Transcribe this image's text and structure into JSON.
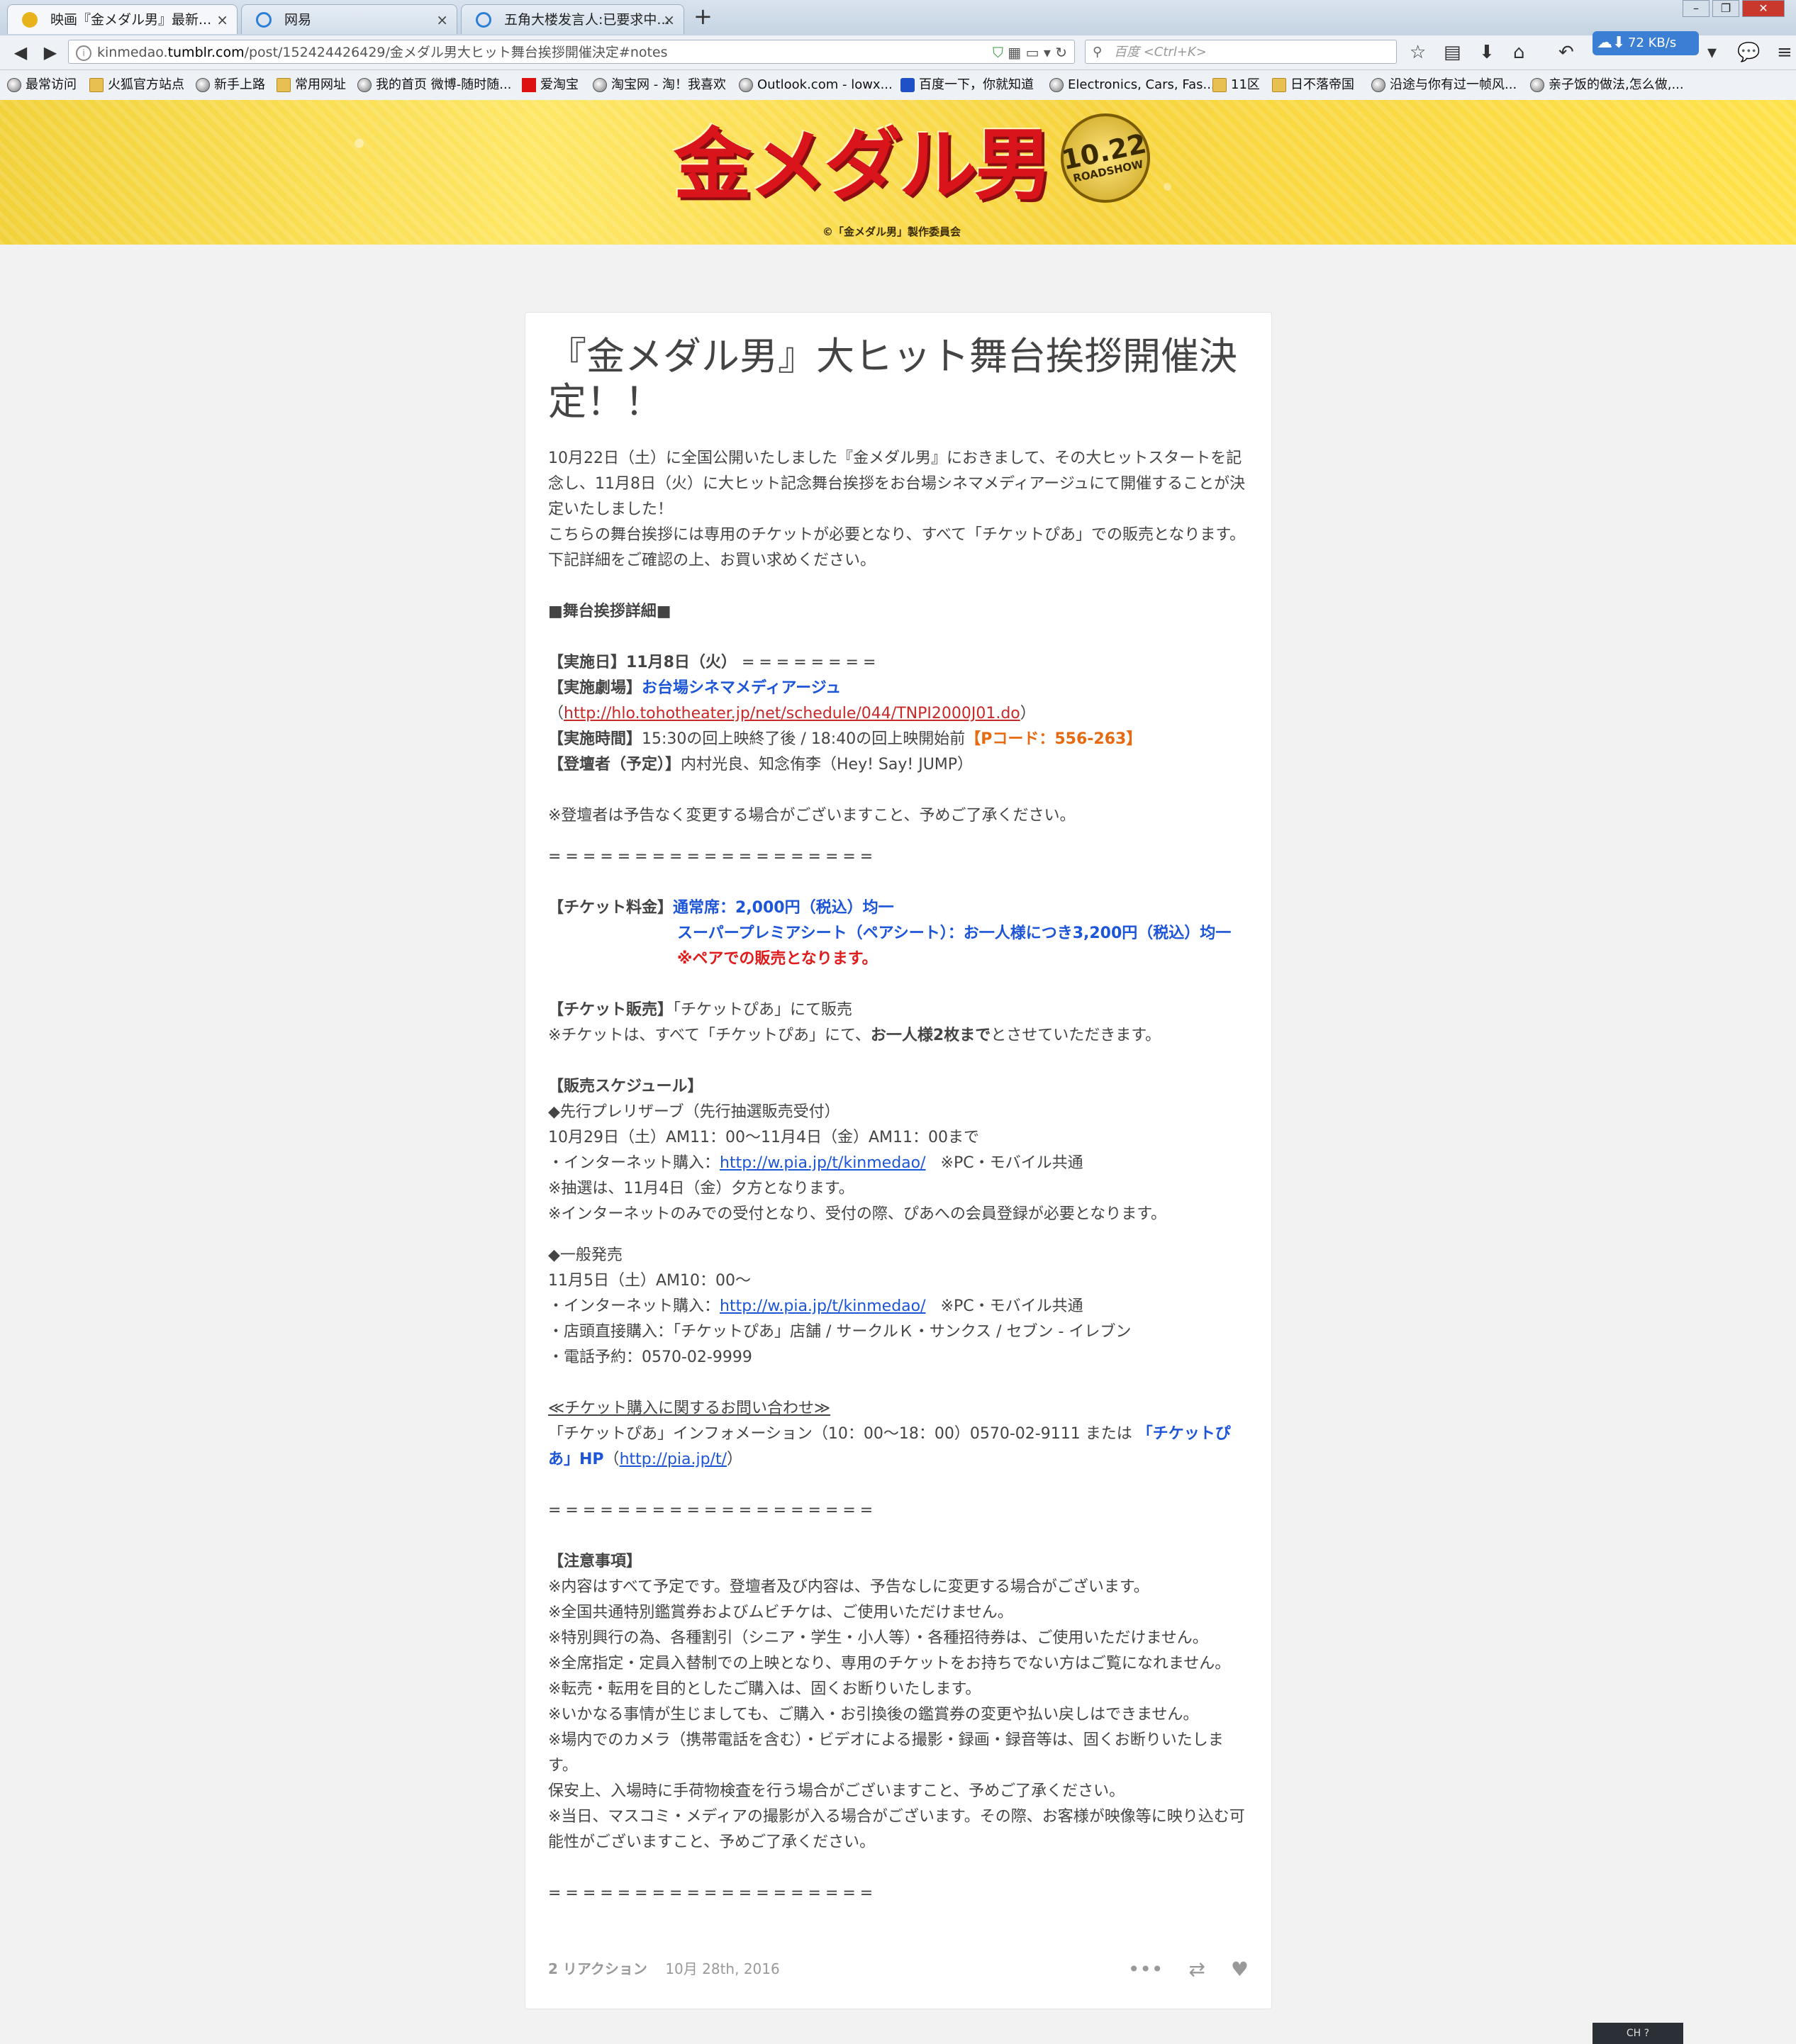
{
  "browser": {
    "tabs": [
      {
        "title": "映画『金メダル男』最新...",
        "active": true
      },
      {
        "title": "网易",
        "active": false
      },
      {
        "title": "五角大楼发言人:已要求中...",
        "active": false
      }
    ],
    "new_tab": "+",
    "url_prefix": "kinmedao.",
    "url_host": "tumblr.com",
    "url_path": "/post/152424426429/金メダル男大ヒット舞台挨拶開催決定#notes",
    "search_placeholder": "百度 <Ctrl+K>",
    "download_speed": "72 KB/s",
    "bookmarks": [
      {
        "label": "最常访问",
        "icon": "globe"
      },
      {
        "label": "火狐官方站点",
        "icon": "folder"
      },
      {
        "label": "新手上路",
        "icon": "globe"
      },
      {
        "label": "常用网址",
        "icon": "folder"
      },
      {
        "label": "我的首页 微博-随时随...",
        "icon": "globe"
      },
      {
        "label": "爱淘宝",
        "icon": "red"
      },
      {
        "label": "淘宝网 - 淘！我喜欢",
        "icon": "globe"
      },
      {
        "label": "Outlook.com - lowx...",
        "icon": "globe"
      },
      {
        "label": "百度一下，你就知道",
        "icon": "paw"
      },
      {
        "label": "Electronics, Cars, Fas...",
        "icon": "globe"
      },
      {
        "label": "11区",
        "icon": "folder"
      },
      {
        "label": "日不落帝国",
        "icon": "folder"
      },
      {
        "label": "沿途与你有过一帧风...",
        "icon": "globe"
      },
      {
        "label": "亲子饭的做法,怎么做,...",
        "icon": "globe"
      }
    ]
  },
  "banner": {
    "logo_text": "金メダル男",
    "badge_date": "10.22",
    "badge_sub": "ROADSHOW",
    "copyright": "©「金メダル男」製作委員会"
  },
  "post": {
    "title": "『金メダル男』大ヒット舞台挨拶開催決定！！",
    "intro": [
      "10月22日（土）に全国公開いたしました『金メダル男』におきまして、その大ヒットスタートを記念し、11月8日（火）に大ヒット記念舞台挨拶をお台場シネマメディアージュにて開催することが決定いたしました！",
      "こちらの舞台挨拶には専用のチケットが必要となり、すべて「チケットぴあ」での販売となります。",
      "下記詳細をご確認の上、お買い求めください。"
    ],
    "section_details": "■舞台挨拶詳細■",
    "date_label": "【実施日】11月8日（火）",
    "date_eq": "========",
    "venue_label": "【実施劇場】",
    "venue_name": "お台場シネマメディアージュ",
    "venue_open": "（",
    "venue_url": "http://hlo.tohotheater.jp/net/schedule/044/TNPI2000J01.do",
    "venue_close": "）",
    "time_label": "【実施時間】",
    "time_text": "15:30の回上映終了後 / 18:40の回上映開始前",
    "pcode": "【Pコード：556-263】",
    "guests_label": "【登壇者（予定）】",
    "guests_text": "内村光良、知念侑李（Hey! Say! JUMP）",
    "guest_note": "※登壇者は予告なく変更する場合がございますこと、予めご了承ください。",
    "separator": "===================",
    "price_label": "【チケット料金】",
    "price_regular": "通常席：2,000円（税込）均一",
    "price_premium": "スーパープレミアシート（ペアシート）：お一人様につき3,200円（税込）均一",
    "price_pair_note": "※ペアでの販売となります。",
    "sales_label": "【チケット販売】",
    "sales_text": "「チケットぴあ」にて販売",
    "sales_note_pre": "※チケットは、すべて「チケットぴあ」にて、",
    "sales_note_bold": "お一人様2枚まで",
    "sales_note_post": "とさせていただきます。",
    "schedule_label": "【販売スケジュール】",
    "presale_head": "◆先行プレリザーブ（先行抽選販売受付）",
    "presale_period": "10月29日（土）AM11：00～11月4日（金）AM11：00まで",
    "net_purchase": "・インターネット購入：",
    "pia_url": "http://w.pia.jp/t/kinmedao/",
    "pc_mobile": "※PC・モバイル共通",
    "lottery_note": "※抽選は、11月4日（金）夕方となります。",
    "internet_only_note": "※インターネットのみでの受付となり、受付の際、ぴあへの会員登録が必要となります。",
    "general_head": "◆一般発売",
    "general_date": "11月5日（土）AM10：00～",
    "store_purchase": "・店頭直接購入：「チケットぴあ」店舗 / サークルＫ・サンクス / セブン - イレブン",
    "phone_reserve": "・電話予約：0570-02-9999",
    "inquiry_head": "≪チケット購入に関するお問い合わせ≫",
    "inquiry_text": "「チケットぴあ」インフォメーション（10：00～18：00）0570-02-9111 または",
    "inquiry_hp": "「チケットぴあ」HP",
    "inquiry_open": "（",
    "inquiry_url": "http://pia.jp/t/",
    "inquiry_close": "）",
    "notes_label": "【注意事項】",
    "notes": [
      "※内容はすべて予定です。登壇者及び内容は、予告なしに変更する場合がございます。",
      "※全国共通特別鑑賞券およびムビチケは、ご使用いただけません。",
      "※特別興行の為、各種割引（シニア・学生・小人等）・各種招待券は、ご使用いただけません。",
      "※全席指定・定員入替制での上映となり、専用のチケットをお持ちでない方はご覧になれません。",
      "※転売・転用を目的としたご購入は、固くお断りいたします。",
      "※いかなる事情が生じましても、ご購入・お引換後の鑑賞券の変更や払い戻しはできません。",
      "※場内でのカメラ（携帯電話を含む）・ビデオによる撮影・録画・録音等は、固くお断りいたします。",
      "保安上、入場時に手荷物検査を行う場合がございますこと、予めご了承ください。",
      "※当日、マスコミ・メディアの撮影が入る場合がございます。その際、お客様が映像等に映り込む可能性がございますこと、予めご了承ください。"
    ],
    "footer_notes": "2 リアクション",
    "footer_date": "10月 28th, 2016"
  },
  "taskbar": {
    "text": "CH"
  }
}
